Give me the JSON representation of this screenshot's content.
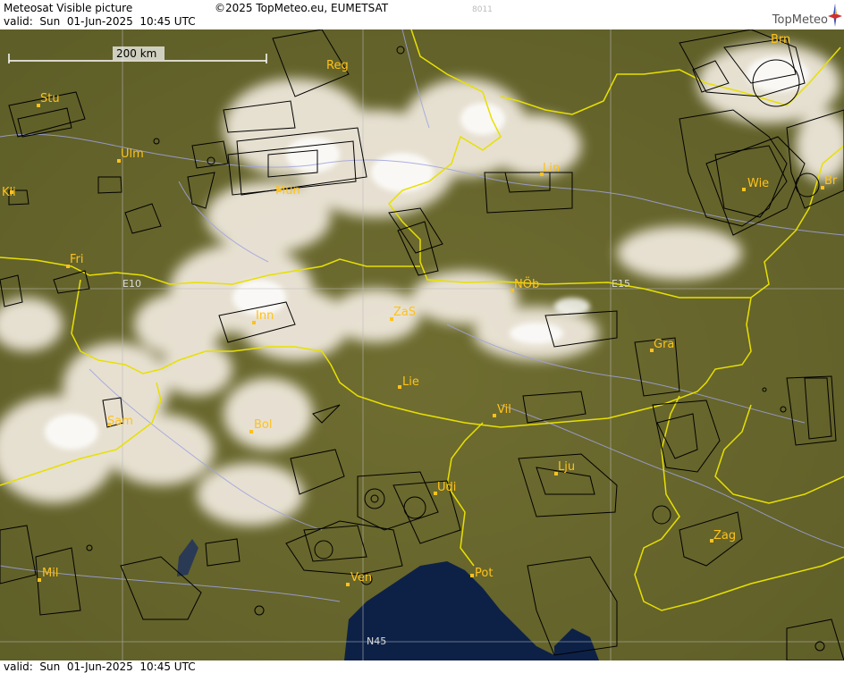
{
  "header": {
    "title": "Meteosat Visible picture",
    "copyright": "©2025 TopMeteo.eu, EUMETSAT",
    "code": "8011",
    "valid": "valid:  Sun  01-Jun-2025  10:45 UTC",
    "logo": "TopMeteo"
  },
  "footer": {
    "valid": "valid:  Sun  01-Jun-2025  10:45 UTC"
  },
  "scale": {
    "label": "200 km"
  },
  "grid_labels": {
    "e10": "E10",
    "e15": "E15",
    "n45": "N45"
  },
  "cities": {
    "stu": "Stu",
    "ulm": "Ulm",
    "mun": "Mün",
    "reg": "Reg",
    "brn": "Brn",
    "lin": "Lin",
    "wie": "Wie",
    "br": "Br",
    "kli": "Kli",
    "fri": "Fri",
    "inn": "Inn",
    "zas": "ZaS",
    "nob": "NÖb",
    "gra": "Gra",
    "sam": "Sam",
    "bol": "Bol",
    "lie": "Lie",
    "vil": "Vil",
    "lju": "Lju",
    "udi": "Udi",
    "zag": "Zag",
    "mil": "Mil",
    "ven": "Ven",
    "pot": "Pot"
  },
  "colors": {
    "land": "#6b6a2e",
    "sea": "#0d2147",
    "border": "#e8e000",
    "river": "#9fa3e0",
    "airspace": "#000000",
    "city": "#ffc21a"
  }
}
